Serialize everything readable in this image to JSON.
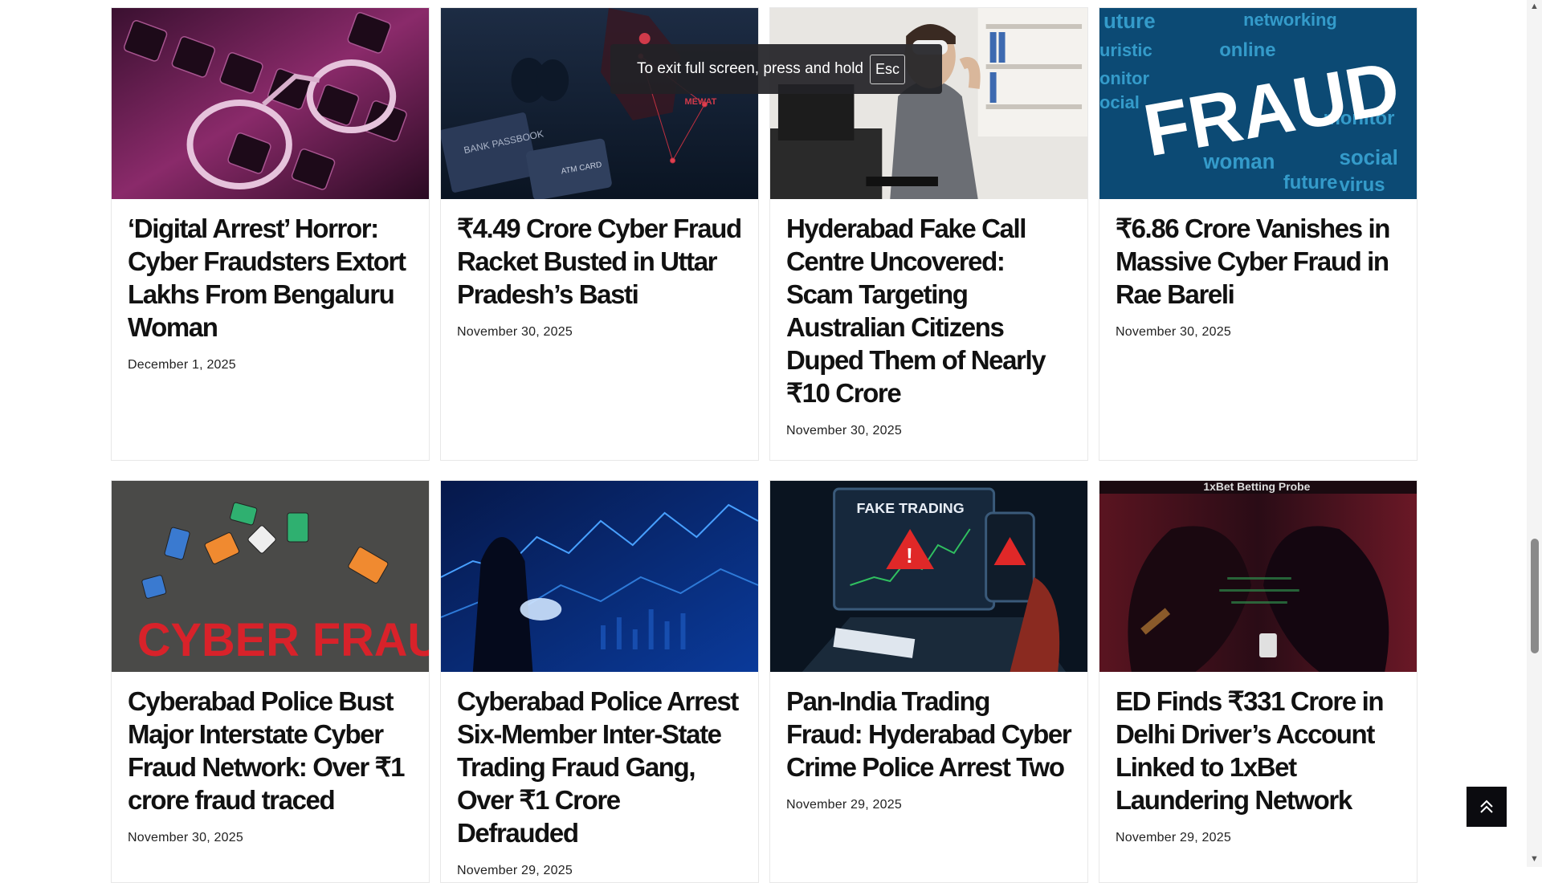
{
  "fullscreen_toast": {
    "text": "To exit full screen, press and hold",
    "key": "Esc"
  },
  "articles": [
    {
      "title": "‘Digital Arrest’ Horror: Cyber Fraudsters Extort Lakhs From Bengaluru Woman",
      "date": "December 1, 2025",
      "image": "handcuffs-on-keyboard"
    },
    {
      "title": "₹4.49 Crore Cyber Fraud Racket Busted in Uttar Pradesh’s Basti",
      "date": "November 30, 2025",
      "image": "bank-passbook-atm-card-map"
    },
    {
      "title": "Hyderabad Fake Call Centre Uncovered: Scam Targeting Australian Citizens Duped Them of Nearly ₹10 Crore",
      "date": "November 30, 2025",
      "image": "masked-man-on-phone"
    },
    {
      "title": "₹6.86 Crore Vanishes in Massive Cyber Fraud in Rae Bareli",
      "date": "November 30, 2025",
      "image": "fraud-word-cloud"
    },
    {
      "title": "Cyberabad Police Bust Major Interstate Cyber Fraud Network: Over ₹1 crore fraud traced",
      "date": "November 30, 2025",
      "image": "sim-cards-cyber-fraud"
    },
    {
      "title": "Cyberabad Police Arrest Six-Member Inter-State Trading Fraud Gang, Over ₹1 Crore Defrauded",
      "date": "November 29, 2025",
      "image": "hooded-hacker-charts"
    },
    {
      "title": "Pan-India Trading Fraud: Hyderabad Cyber Crime Police Arrest Two",
      "date": "November 29, 2025",
      "image": "fake-trading-laptop"
    },
    {
      "title": "ED Finds ₹331 Crore in Delhi Driver’s Account Linked to 1xBet Laundering Network",
      "date": "November 29, 2025",
      "image": "1xbet-betting-probe"
    }
  ],
  "image_text": {
    "bank": "BANK PASSBOOK",
    "atm": "ATM CARD",
    "mewat": "MEWAT",
    "fraud": "FRAUD",
    "cyber_fraud": "CYBER FRAUD",
    "fake_trading": "FAKE TRADING",
    "probe": "1xBet Betting Probe"
  },
  "icons": {
    "back_to_top": "chevron-up-icon"
  }
}
